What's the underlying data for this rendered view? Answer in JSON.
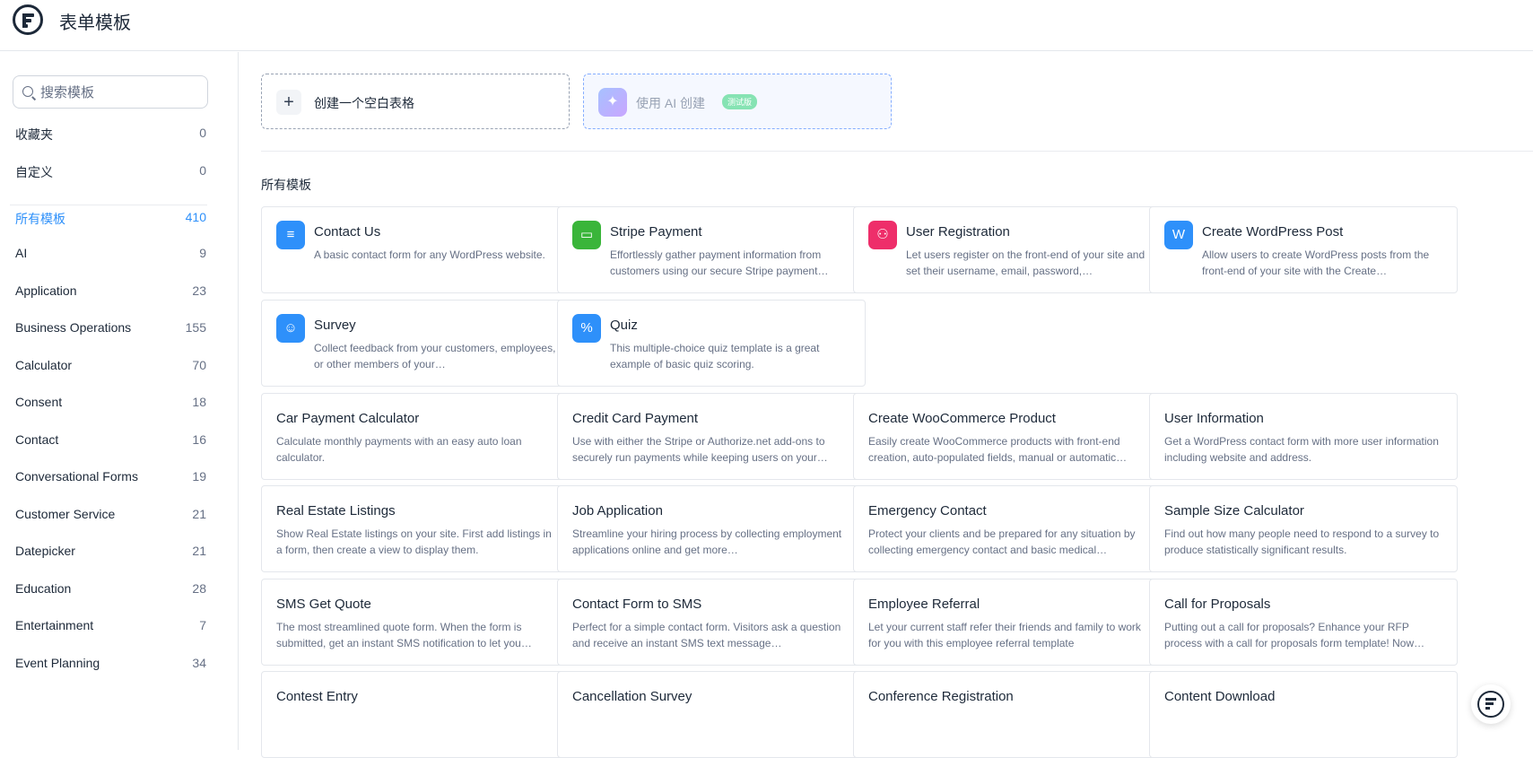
{
  "header": {
    "title": "表单模板"
  },
  "sidebar": {
    "search_placeholder": "搜索模板",
    "categories": [
      {
        "label": "收藏夹",
        "count": "0"
      },
      {
        "label": "自定义",
        "count": "0"
      },
      {
        "label": "所有模板",
        "count": "410",
        "active": true
      },
      {
        "label": "AI",
        "count": "9"
      },
      {
        "label": "Application",
        "count": "23"
      },
      {
        "label": "Business Operations",
        "count": "155"
      },
      {
        "label": "Calculator",
        "count": "70"
      },
      {
        "label": "Consent",
        "count": "18"
      },
      {
        "label": "Contact",
        "count": "16"
      },
      {
        "label": "Conversational Forms",
        "count": "19"
      },
      {
        "label": "Customer Service",
        "count": "21"
      },
      {
        "label": "Datepicker",
        "count": "21"
      },
      {
        "label": "Education",
        "count": "28"
      },
      {
        "label": "Entertainment",
        "count": "7"
      },
      {
        "label": "Event Planning",
        "count": "34"
      }
    ]
  },
  "main": {
    "create_blank_label": "创建一个空白表格",
    "create_ai_label": "使用 AI 创建",
    "beta_badge": "测试版",
    "section_title": "所有模板",
    "featured": [
      {
        "name": "Contact Us",
        "desc": "A basic contact form for any WordPress website.",
        "icon": "list-icon",
        "color": "#2e90fa"
      },
      {
        "name": "Stripe Payment",
        "desc": "Effortlessly gather payment information from customers using our secure Stripe payment…",
        "icon": "credit-card-icon",
        "color": "#3ab53a"
      },
      {
        "name": "User Registration",
        "desc": "Let users register on the front-end of your site and set their username, email, password,…",
        "icon": "user-plus-icon",
        "color": "#ee2e6a"
      },
      {
        "name": "Create WordPress Post",
        "desc": "Allow users to create WordPress posts from the front-end of your site with the Create…",
        "icon": "wordpress-icon",
        "color": "#2e90fa"
      },
      {
        "name": "Survey",
        "desc": "Collect feedback from your customers, employees, or other members of your…",
        "icon": "smile-icon",
        "color": "#2e90fa"
      },
      {
        "name": "Quiz",
        "desc": "This multiple-choice quiz template is a great example of basic quiz scoring.",
        "icon": "percent-icon",
        "color": "#2e90fa"
      }
    ],
    "templates": [
      {
        "name": "Car Payment Calculator",
        "desc": "Calculate monthly payments with an easy auto loan calculator."
      },
      {
        "name": "Credit Card Payment",
        "desc": "Use with either the Stripe or Authorize.net add-ons to securely run payments while keeping users on your…"
      },
      {
        "name": "Create WooCommerce Product",
        "desc": "Easily create WooCommerce products with front-end creation, auto-populated fields, manual or automatic…"
      },
      {
        "name": "User Information",
        "desc": "Get a WordPress contact form with more user information including website and address."
      },
      {
        "name": "Real Estate Listings",
        "desc": "Show Real Estate listings on your site. First add listings in a form, then create a view to display them."
      },
      {
        "name": "Job Application",
        "desc": "Streamline your hiring process by collecting employment applications online and get more…"
      },
      {
        "name": "Emergency Contact",
        "desc": "Protect your clients and be prepared for any situation by collecting emergency contact and basic medical…"
      },
      {
        "name": "Sample Size Calculator",
        "desc": "Find out how many people need to respond to a survey to produce statistically significant results."
      },
      {
        "name": "SMS Get Quote",
        "desc": "The most streamlined quote form. When the form is submitted, get an instant SMS notification to let you…"
      },
      {
        "name": "Contact Form to SMS",
        "desc": "Perfect for a simple contact form. Visitors ask a question and receive an instant SMS text message…"
      },
      {
        "name": "Employee Referral",
        "desc": "Let your current staff refer their friends and family to work for you with this employee referral template"
      },
      {
        "name": "Call for Proposals",
        "desc": "Putting out a call for proposals? Enhance your RFP process with a call for proposals form template! Now…"
      },
      {
        "name": "Contest Entry",
        "desc": ""
      },
      {
        "name": "Cancellation Survey",
        "desc": ""
      },
      {
        "name": "Conference Registration",
        "desc": ""
      },
      {
        "name": "Content Download",
        "desc": ""
      }
    ]
  }
}
